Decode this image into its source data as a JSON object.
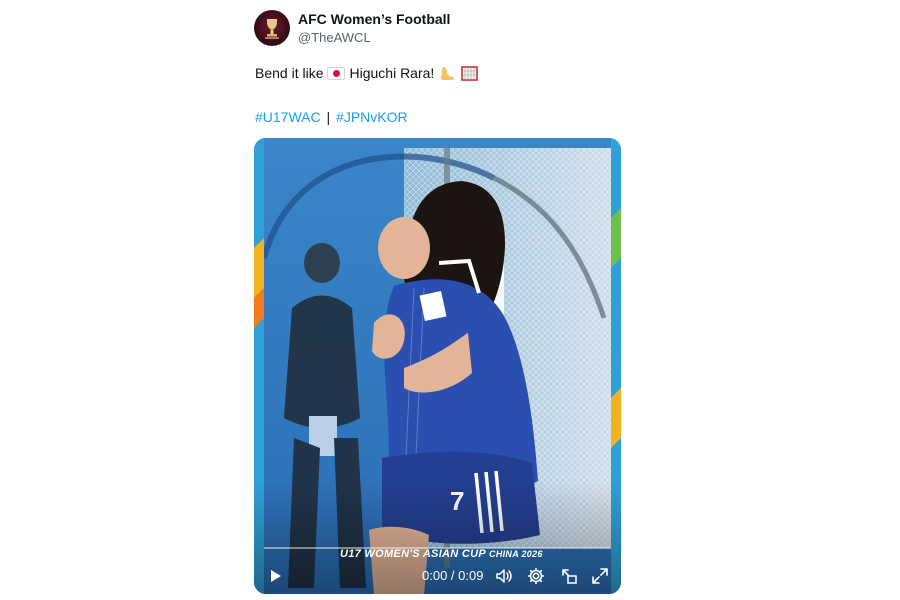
{
  "account": {
    "display_name": "AFC Women’s Football",
    "handle": "@TheAWCL",
    "avatar_icon": "afc-trophy-logo"
  },
  "tweet": {
    "text_before_flag": "Bend it like",
    "text_after_flag": "Higuchi Rara!",
    "flag_icon": "japan-flag-emoji",
    "emoji_1": "foot-emoji",
    "emoji_2": "goal-net-emoji",
    "hashtags": [
      "#U17WAC",
      "#JPNvKOR"
    ],
    "hashtag_separator": "|"
  },
  "video": {
    "watermark": "U17 WOMEN'S ASIAN CUP",
    "watermark_sub": "CHINA 2026",
    "time": "0:00 / 0:09",
    "progress": 0,
    "controls": [
      "play-icon",
      "volume-icon",
      "settings-icon",
      "pop-out-icon",
      "fullscreen-icon"
    ]
  },
  "colors": {
    "link": "#1d9bf0",
    "kit_blue": "#2a4fb0"
  }
}
